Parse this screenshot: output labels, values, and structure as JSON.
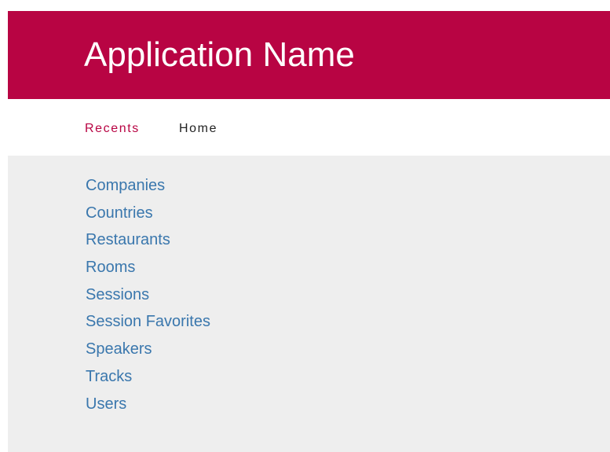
{
  "app": {
    "title": "Application Name",
    "brand_color": "#b80443"
  },
  "nav": {
    "items": [
      {
        "label": "Recents",
        "active": true
      },
      {
        "label": "Home",
        "active": false
      }
    ]
  },
  "main": {
    "link_color": "#3a77ad",
    "background_color": "#eeeeee",
    "links": [
      {
        "label": "Companies"
      },
      {
        "label": "Countries"
      },
      {
        "label": "Restaurants"
      },
      {
        "label": "Rooms"
      },
      {
        "label": "Sessions"
      },
      {
        "label": "Session Favorites"
      },
      {
        "label": "Speakers"
      },
      {
        "label": "Tracks"
      },
      {
        "label": "Users"
      }
    ]
  }
}
